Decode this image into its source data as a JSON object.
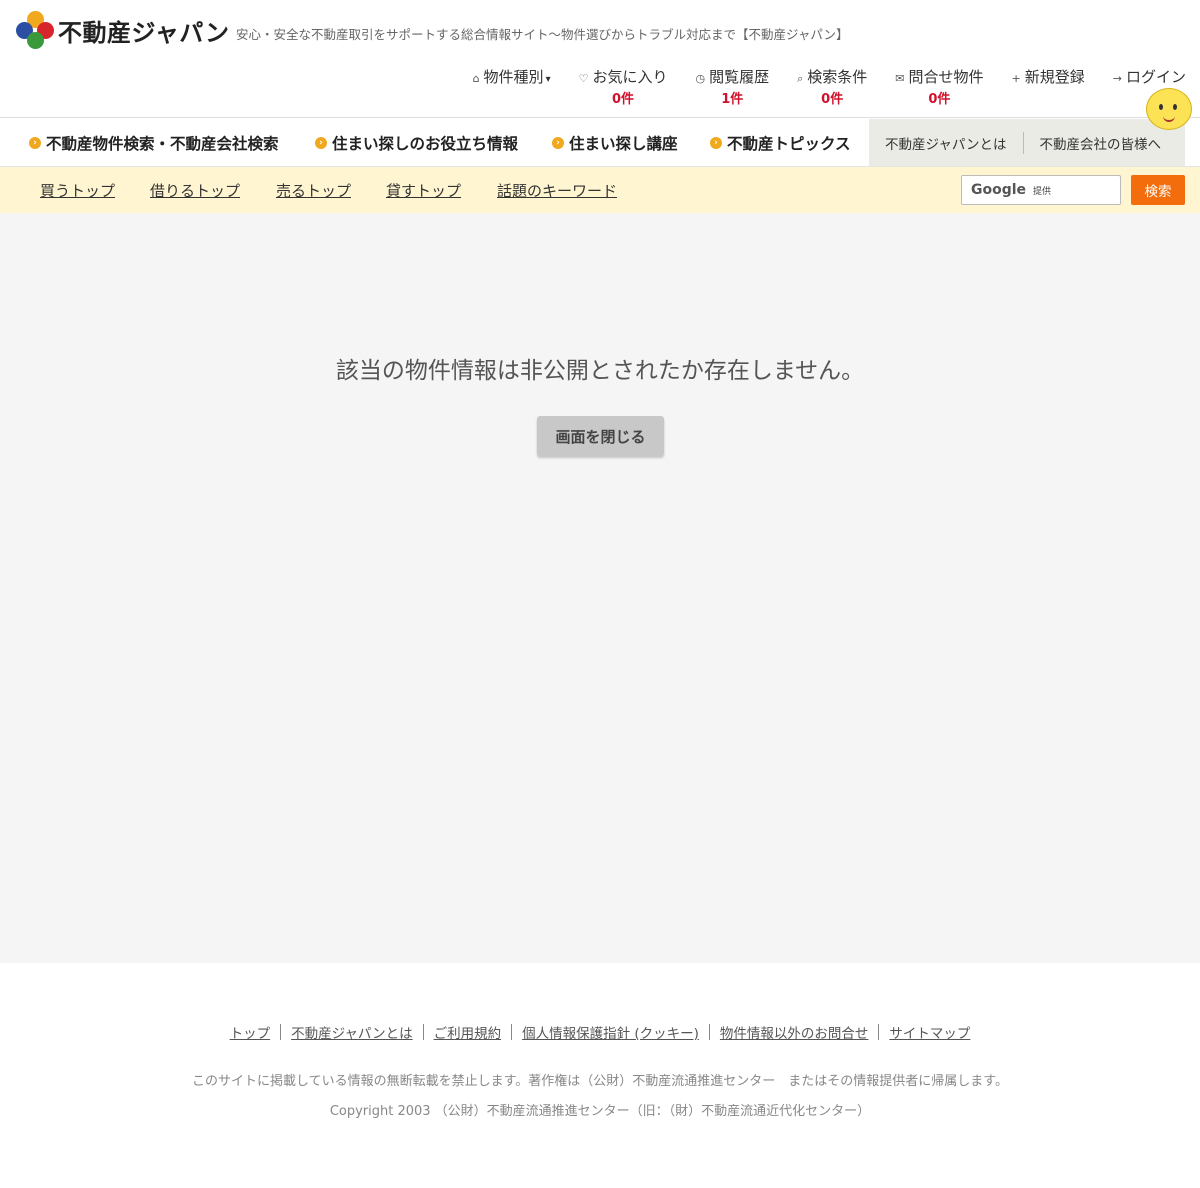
{
  "header": {
    "logo_text": "不動産ジャパン",
    "tagline": "安心・安全な不動産取引をサポートする総合情報サイト〜物件選びからトラブル対応まで【不動産ジャパン】",
    "util_nav": [
      {
        "label": "物件種別",
        "icon": "home-icon"
      },
      {
        "label": "お気に入り",
        "icon": "heart-icon",
        "count": "0件"
      },
      {
        "label": "閲覧履歴",
        "icon": "history-icon",
        "count": "1件"
      },
      {
        "label": "検索条件",
        "icon": "search-icon",
        "count": "0件"
      },
      {
        "label": "問合せ物件",
        "icon": "mail-icon",
        "count": "0件"
      },
      {
        "label": "新規登録",
        "icon": "user-plus-icon"
      },
      {
        "label": "ログイン",
        "icon": "login-icon"
      }
    ]
  },
  "main_nav": {
    "items": [
      "不動産物件検索・不動産会社検索",
      "住まい探しのお役立ち情報",
      "住まい探し講座",
      "不動産トピックス"
    ],
    "sub_links": [
      "不動産ジャパンとは",
      "不動産会社の皆様へ"
    ]
  },
  "sub_bar": {
    "links": [
      "買うトップ",
      "借りるトップ",
      "売るトップ",
      "貸すトップ",
      "話題のキーワード"
    ],
    "search": {
      "brand": "Google",
      "provided": "提供",
      "button": "検索"
    }
  },
  "main": {
    "message": "該当の物件情報は非公開とされたか存在しません。",
    "close_button": "画面を閉じる"
  },
  "footer": {
    "links": [
      "トップ",
      "不動産ジャパンとは",
      "ご利用規約",
      "個人情報保護指針 (クッキー)",
      "物件情報以外のお問合せ",
      "サイトマップ"
    ],
    "notice": "このサイトに掲載している情報の無断転載を禁止します。著作権は（公財）不動産流通推進センター　またはその情報提供者に帰属します。",
    "copyright": "Copyright 2003 （公財）不動産流通推進センター（旧：（財）不動産流通近代化センター）"
  },
  "colors": {
    "accent_orange": "#f36d0c",
    "count_red": "#d0112b",
    "subbar_bg": "#fff5d1",
    "nav_dot": "#f0a81e"
  }
}
